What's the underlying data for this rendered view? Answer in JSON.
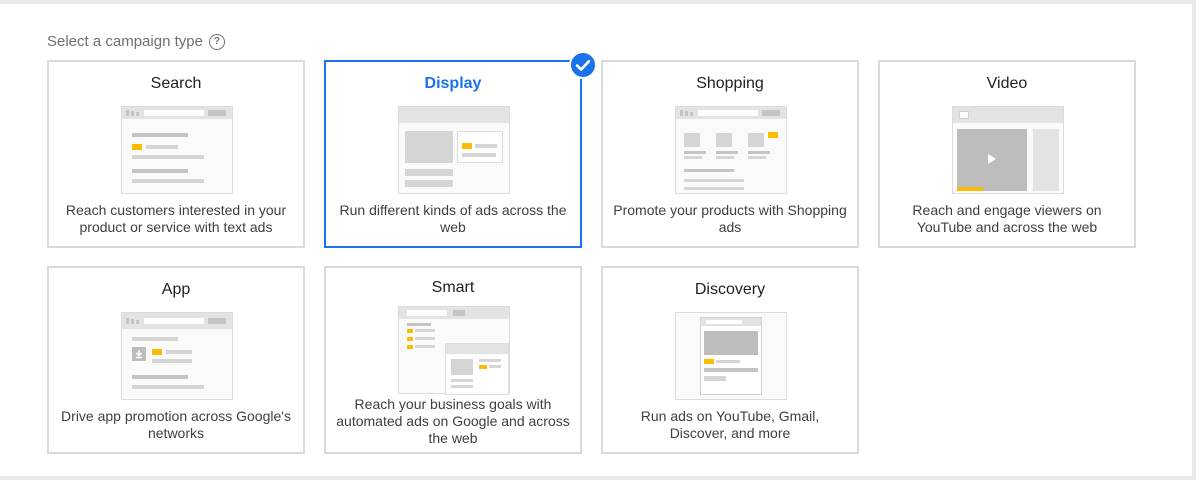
{
  "heading": {
    "label": "Select a campaign type",
    "help_icon": "help-circle-icon"
  },
  "accent_color": "#1a73e8",
  "highlight_color": "#fbbc04",
  "selected_card": "Display",
  "cards": [
    {
      "title": "Search",
      "description": "Reach customers interested in your product or service with text ads"
    },
    {
      "title": "Display",
      "description": "Run different kinds of ads across the web"
    },
    {
      "title": "Shopping",
      "description": "Promote your products with Shopping ads"
    },
    {
      "title": "Video",
      "description": "Reach and engage viewers on YouTube and across the web"
    },
    {
      "title": "App",
      "description": "Drive app promotion across Google's networks"
    },
    {
      "title": "Smart",
      "description": "Reach your business goals with automated ads on Google and across the web"
    },
    {
      "title": "Discovery",
      "description": "Run ads on YouTube, Gmail, Discover, and more"
    }
  ]
}
